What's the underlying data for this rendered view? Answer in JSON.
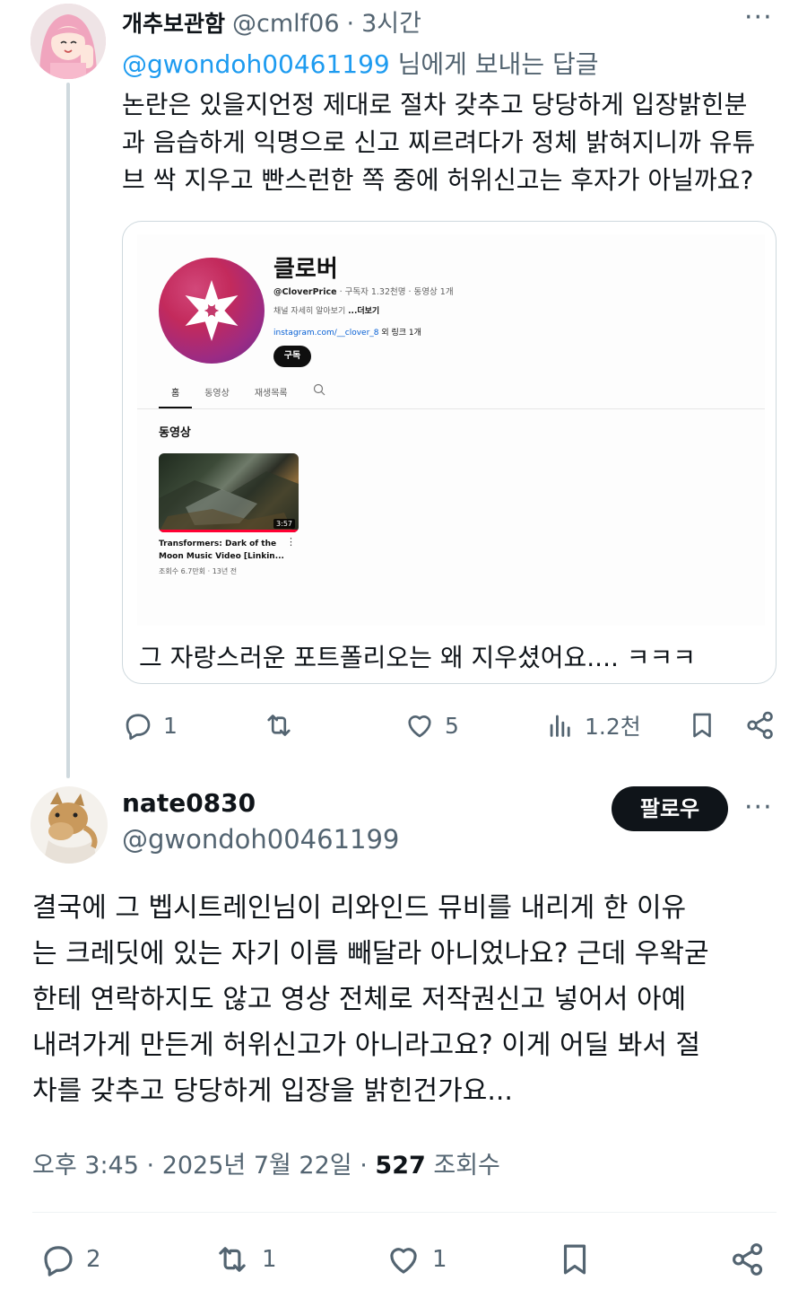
{
  "reply": {
    "display_name": "개추보관함",
    "handle": "@cmlf06",
    "separator": "·",
    "time": "3시간",
    "more": "···",
    "reply_to_handle": "@gwondoh00461199",
    "reply_to_suffix": " 님에게 보내는 답글",
    "text": "논란은 있을지언정 제대로 절차 갖추고 당당하게 입장밝힌분\n과 음습하게 익명으로 신고 찌르려다가 정체 밝혀지니까 유튜\n브 싹 지우고 빤스런한 쪽 중에 허위신고는 후자가 아닐까요?",
    "card": {
      "channel_name": "클로버",
      "channel_handle": "@CloverPrice",
      "channel_stats": " · 구독자 1.32천명 · 동영상 1개",
      "description": "채널 자세히 알아보기 ",
      "description_more": "...더보기",
      "link": "instagram.com/__clover_8",
      "link_more": " 외 링크 1개",
      "subscribe": "구독",
      "tabs": [
        "홈",
        "동영상",
        "재생목록"
      ],
      "section": "동영상",
      "video_title": "Transformers: Dark of the Moon Music Video [Linkin...",
      "video_duration": "3:57",
      "video_meta": "조회수 6.7만회 · 13년 전",
      "video_menu": "⋮",
      "caption": "그 자랑스러운 포트폴리오는 왜 지우셨어요.... ㅋㅋㅋ"
    },
    "actions": {
      "replies": "1",
      "retweets": "",
      "likes": "5",
      "views": "1.2천"
    }
  },
  "main": {
    "display_name": "nate0830",
    "handle": "@gwondoh00461199",
    "follow_label": "팔로우",
    "more": "···",
    "text": "결국에 그 벱시트레인님이 리와인드 뮤비를 내리게 한 이유\n는 크레딧에 있는 자기 이름 빼달라 아니었나요? 근데 우왁굳\n한테 연락하지도 않고 영상 전체로 저작권신고 넣어서 아예\n내려가게 만든게 허위신고가 아니라고요? 이게 어딜 봐서 절\n차를 갖추고 당당하게 입장을 밝힌건가요...",
    "time": "오후 3:45",
    "date": "2025년 7월 22일",
    "separator": "·",
    "views_count": "527",
    "views_label": "조회수",
    "actions": {
      "replies": "2",
      "retweets": "1",
      "likes": "1"
    }
  },
  "colors": {
    "text": "#0f1419",
    "muted": "#536471",
    "link": "#1d9bf0",
    "border": "#cfd9de"
  }
}
